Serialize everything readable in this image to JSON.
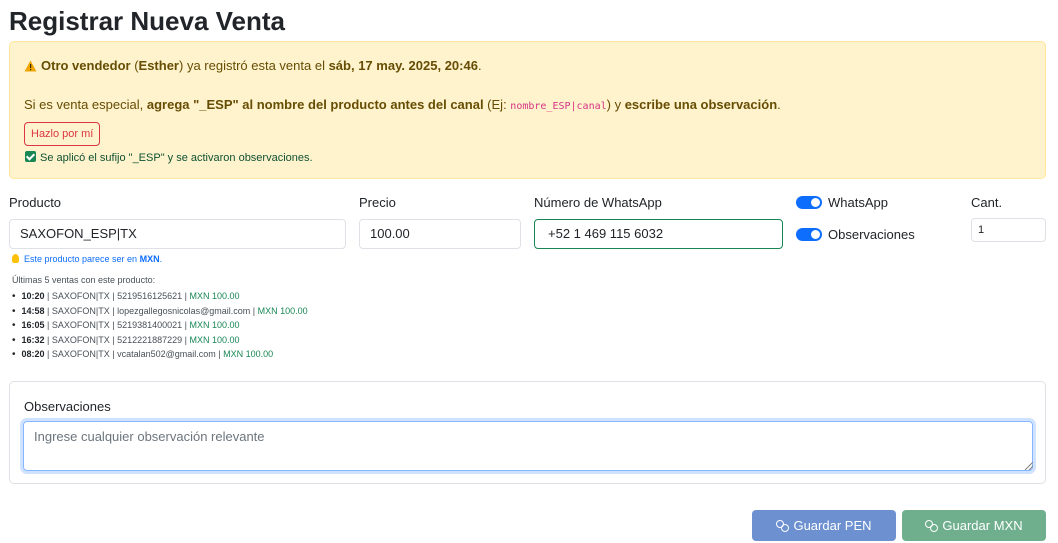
{
  "page": {
    "title": "Registrar Nueva Venta"
  },
  "alert": {
    "p1": "Otro vendedor",
    "p2": " (",
    "p3": "Esther",
    "p4": ") ya registró esta venta el ",
    "p5": "sáb, 17 may. 2025, 20:46",
    "p6": ".",
    "q1": "Si es venta especial, ",
    "q2": "agrega \"_ESP\" al nombre del producto antes del canal",
    "q3": " (Ej: ",
    "q4": "nombre_ESP|canal",
    "q5": ") y ",
    "q6": "escribe una observación",
    "q7": ".",
    "button": "Hazlo por mí",
    "applied": "Se aplicó el sufijo \"_ESP\" y se activaron observaciones."
  },
  "form": {
    "producto_label": "Producto",
    "producto_value": "SAXOFON_ESP|TX",
    "precio_label": "Precio",
    "precio_value": "100.00",
    "whatsapp_label": "Número de WhatsApp",
    "whatsapp_value": "+52 1 469 115 6032",
    "toggle_whatsapp": "WhatsApp",
    "toggle_observaciones": "Observaciones",
    "cant_label": "Cant.",
    "cant_value": "1"
  },
  "hint": {
    "prefix": "Este producto parece ser en ",
    "currency": "MXN",
    "suffix": "."
  },
  "last_sales": {
    "title": "Últimas 5 ventas con este producto:",
    "items": [
      {
        "time": "10:20",
        "info": " | SAXOFON|TX | 5219516125621 | ",
        "amount": "MXN 100.00"
      },
      {
        "time": "14:58",
        "info": " | SAXOFON|TX | lopezgallegosnicolas@gmail.com | ",
        "amount": "MXN 100.00"
      },
      {
        "time": "16:05",
        "info": " | SAXOFON|TX | 5219381400021 | ",
        "amount": "MXN 100.00"
      },
      {
        "time": "16:32",
        "info": " | SAXOFON|TX | 5212221887229 | ",
        "amount": "MXN 100.00"
      },
      {
        "time": "08:20",
        "info": " | SAXOFON|TX | vcatalan502@gmail.com | ",
        "amount": "MXN 100.00"
      }
    ]
  },
  "observaciones": {
    "label": "Observaciones",
    "placeholder": "Ingrese cualquier observación relevante"
  },
  "buttons": {
    "pen": "Guardar PEN",
    "mxn": "Guardar MXN"
  },
  "colors": {
    "alert_bg": "#fff3cd",
    "primary": "#0d6efd",
    "success": "#198754",
    "danger": "#dc3545"
  }
}
